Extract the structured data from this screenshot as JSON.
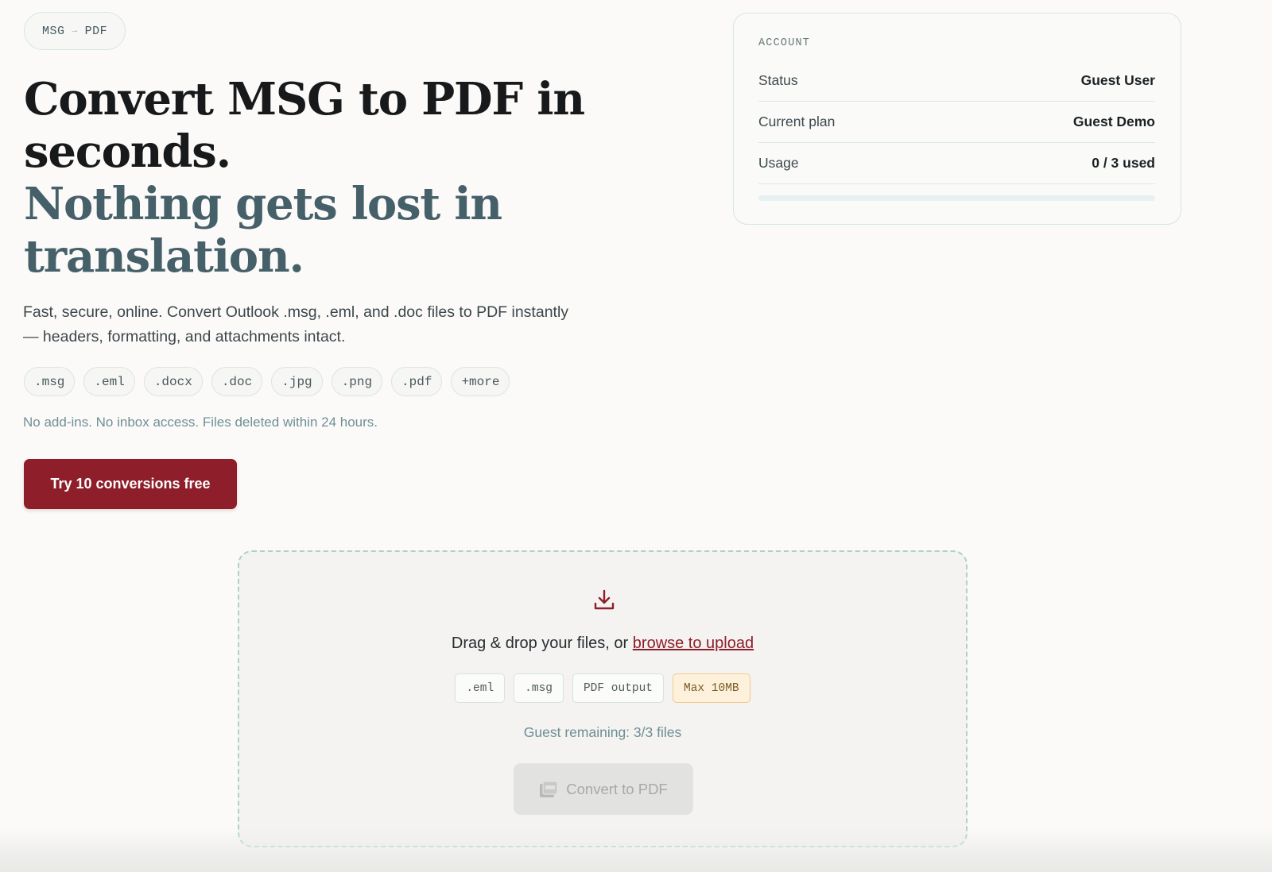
{
  "badge": {
    "from": "MSG",
    "arrow": "→",
    "to": "PDF"
  },
  "hero": {
    "title_line1": "Convert MSG to PDF in seconds.",
    "title_line2": "Nothing gets lost in translation.",
    "subtitle": "Fast, secure, online. Convert Outlook .msg, .eml, and .doc files to PDF instantly — headers, formatting, and attachments intact.",
    "extensions": [
      ".msg",
      ".eml",
      ".docx",
      ".doc",
      ".jpg",
      ".png",
      ".pdf",
      "+more"
    ],
    "privacy_note": "No add-ins. No inbox access. Files deleted within 24 hours.",
    "cta_label": "Try 10 conversions free"
  },
  "account": {
    "title": "ACCOUNT",
    "rows": [
      {
        "label": "Status",
        "value": "Guest User"
      },
      {
        "label": "Current plan",
        "value": "Guest Demo"
      },
      {
        "label": "Usage",
        "value": "0 / 3 used"
      }
    ],
    "usage_fraction": 0
  },
  "dropzone": {
    "prompt": "Drag & drop your files, or",
    "browse_link": "browse to upload",
    "tags": [
      ".eml",
      ".msg",
      "PDF output",
      "Max 10MB"
    ],
    "remaining": "Guest remaining: 3/3 files",
    "convert_label": "Convert to PDF"
  },
  "colors": {
    "brand": "#8e1f2a",
    "headline_accent": "#46606a",
    "dropzone_border": "#a9d4cd",
    "warn_tag_bg": "#fdf1dc"
  },
  "icons": {
    "dropzone": "download-tray-icon",
    "convert": "pdf-file-icon"
  }
}
